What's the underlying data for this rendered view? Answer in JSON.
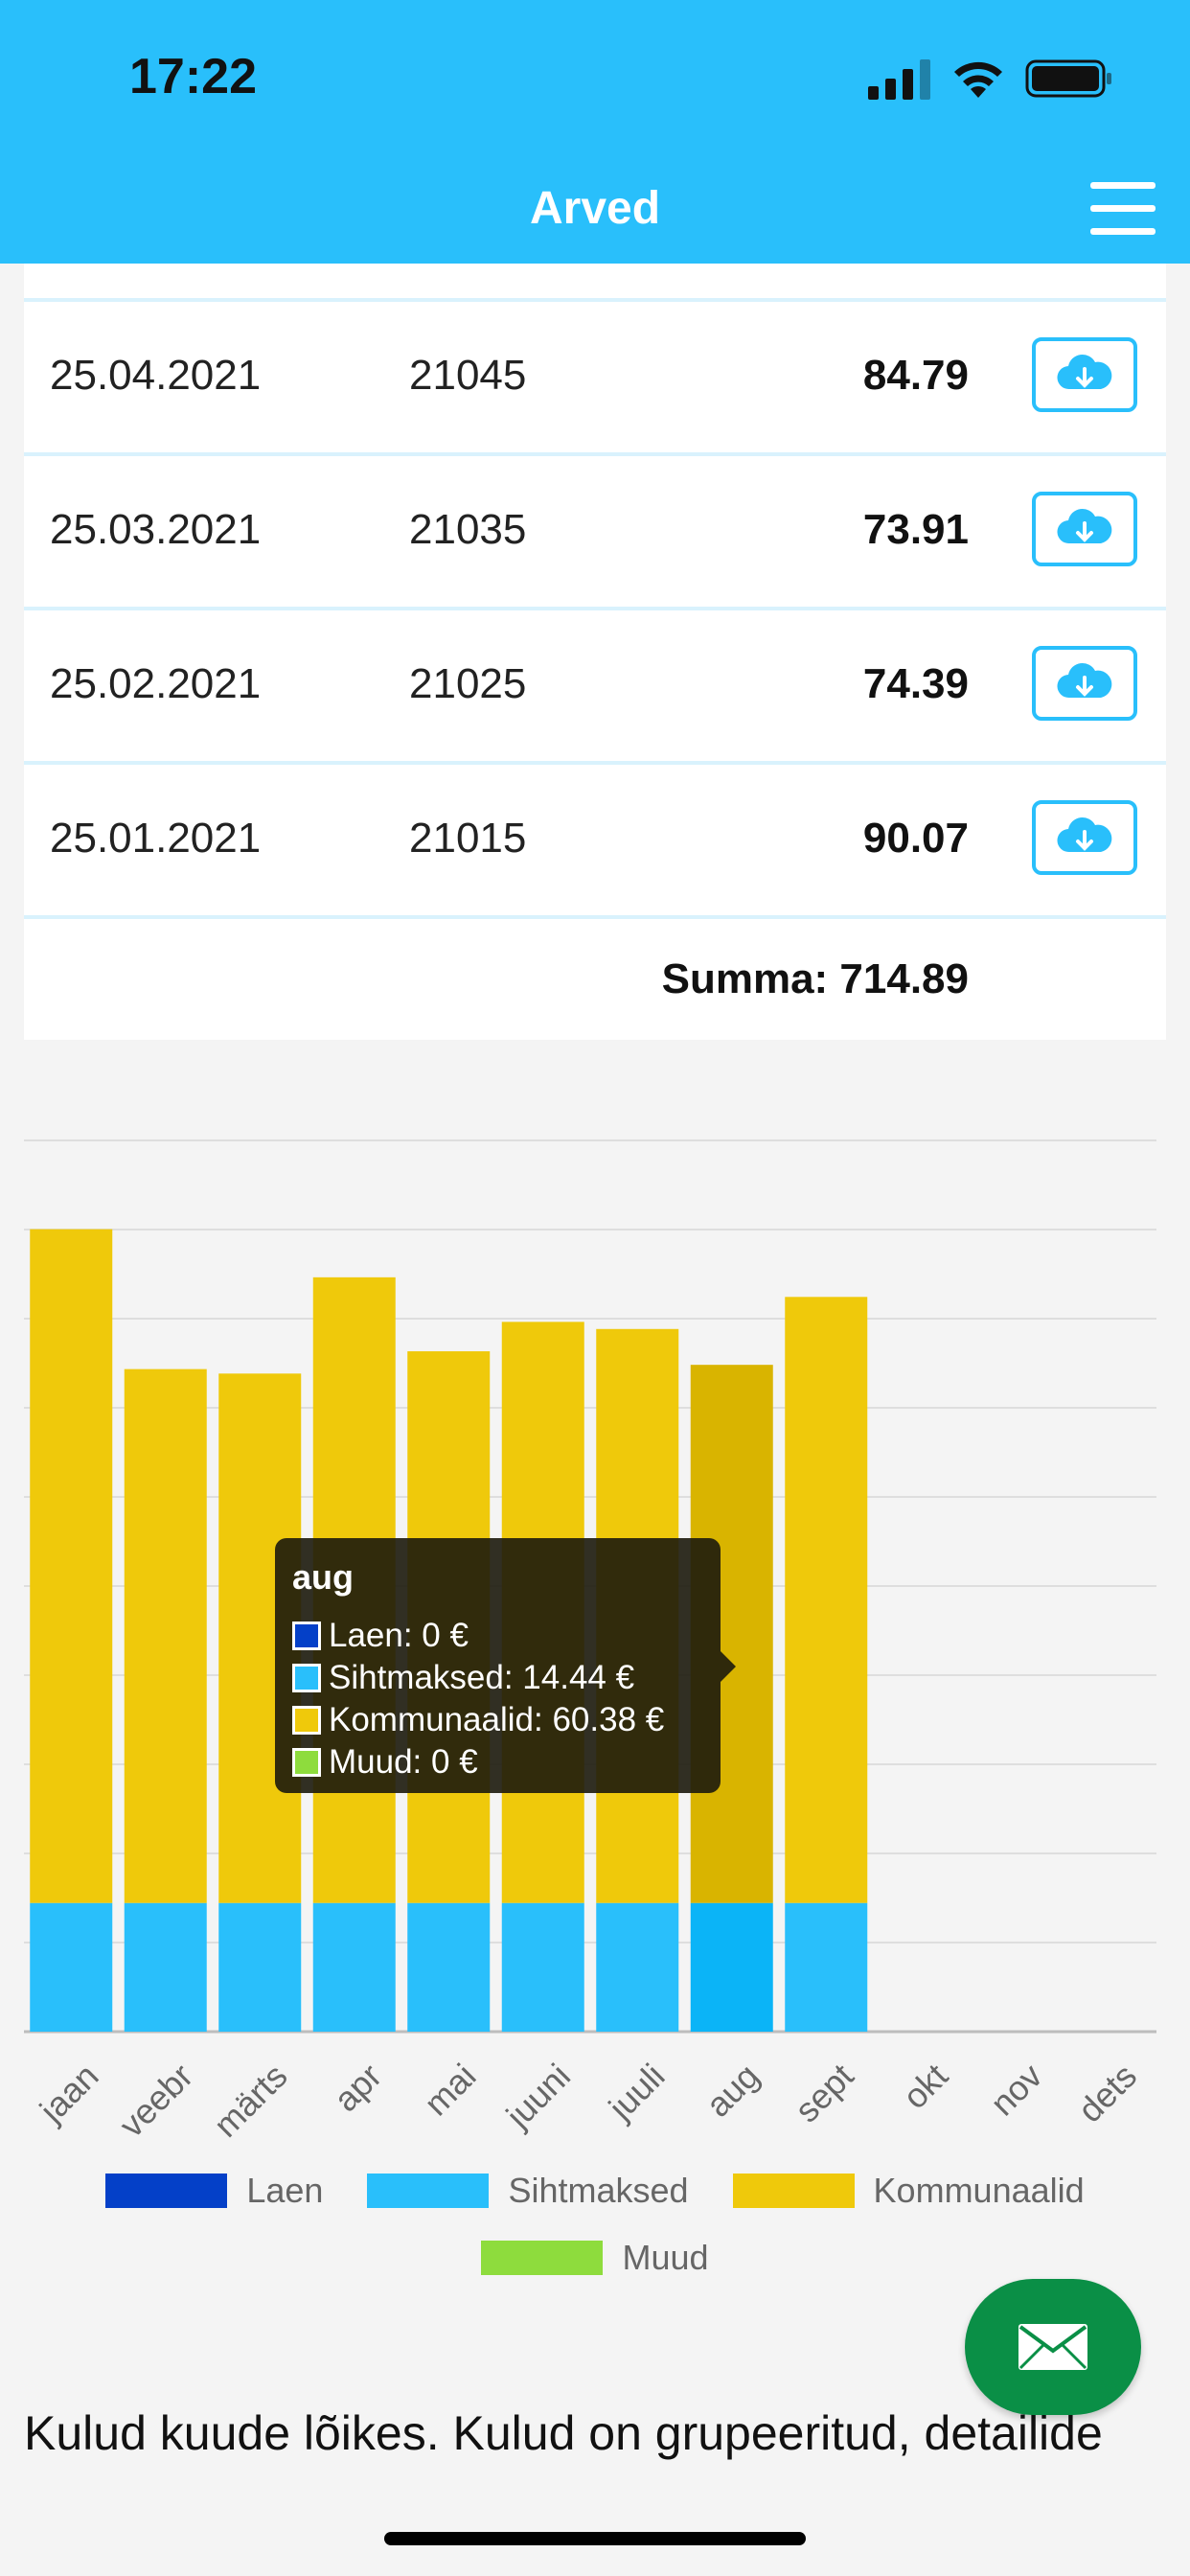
{
  "status_bar": {
    "time": "17:22"
  },
  "header": {
    "title": "Arved"
  },
  "invoices": [
    {
      "date": "25.04.2021",
      "number": "21045",
      "amount": "84.79"
    },
    {
      "date": "25.03.2021",
      "number": "21035",
      "amount": "73.91"
    },
    {
      "date": "25.02.2021",
      "number": "21025",
      "amount": "74.39"
    },
    {
      "date": "25.01.2021",
      "number": "21015",
      "amount": "90.07"
    }
  ],
  "sum_text": "Summa: 714.89",
  "chart_data": {
    "type": "bar",
    "stacked": true,
    "categories": [
      "jaan",
      "veebr",
      "märts",
      "apr",
      "mai",
      "juuni",
      "juuli",
      "aug",
      "sept",
      "okt",
      "nov",
      "dets"
    ],
    "series": [
      {
        "name": "Laen",
        "color": "#0440c8",
        "values": [
          0,
          0,
          0,
          0,
          0,
          0,
          0,
          0,
          0,
          null,
          null,
          null
        ]
      },
      {
        "name": "Sihtmaksed",
        "color": "#29bffb",
        "values": [
          14.44,
          14.44,
          14.44,
          14.44,
          14.44,
          14.44,
          14.44,
          14.44,
          14.44,
          null,
          null,
          null
        ]
      },
      {
        "name": "Kommunaalid",
        "color": "#efc90b",
        "values": [
          75.6,
          59.9,
          59.4,
          70.2,
          61.9,
          65.2,
          64.4,
          60.38,
          68.0,
          null,
          null,
          null
        ]
      },
      {
        "name": "Muud",
        "color": "#8edc3d",
        "values": [
          0,
          0,
          0,
          0,
          0,
          0,
          0,
          0,
          0,
          null,
          null,
          null
        ]
      }
    ],
    "ylim": [
      0,
      100
    ],
    "grid": true,
    "legend_position": "bottom",
    "highlighted_category": "aug",
    "highlight_colors": {
      "Sihtmaksed": "#0bb4f7",
      "Kommunaalid": "#d9b400"
    }
  },
  "tooltip": {
    "title": "aug",
    "lines": [
      {
        "text": "Laen: 0 €",
        "color": "#0440c8"
      },
      {
        "text": "Sihtmaksed: 14.44 €",
        "color": "#29bffb"
      },
      {
        "text": "Kommunaalid: 60.38 €",
        "color": "#efc90b"
      },
      {
        "text": "Muud: 0 €",
        "color": "#8edc3d"
      }
    ]
  },
  "legend": [
    {
      "label": "Laen",
      "color": "#0440c8"
    },
    {
      "label": "Sihtmaksed",
      "color": "#29bffb"
    },
    {
      "label": "Kommunaalid",
      "color": "#efc90b"
    },
    {
      "label": "Muud",
      "color": "#8edc3d"
    }
  ],
  "description": "Kulud kuude lõikes. Kulud on grupeeritud, detailide",
  "icons": {
    "download": "cloud-download-icon",
    "menu": "hamburger-menu-icon",
    "mail": "envelope-icon"
  },
  "colors": {
    "brand": "#29bffb",
    "fab": "#0a8f46"
  }
}
